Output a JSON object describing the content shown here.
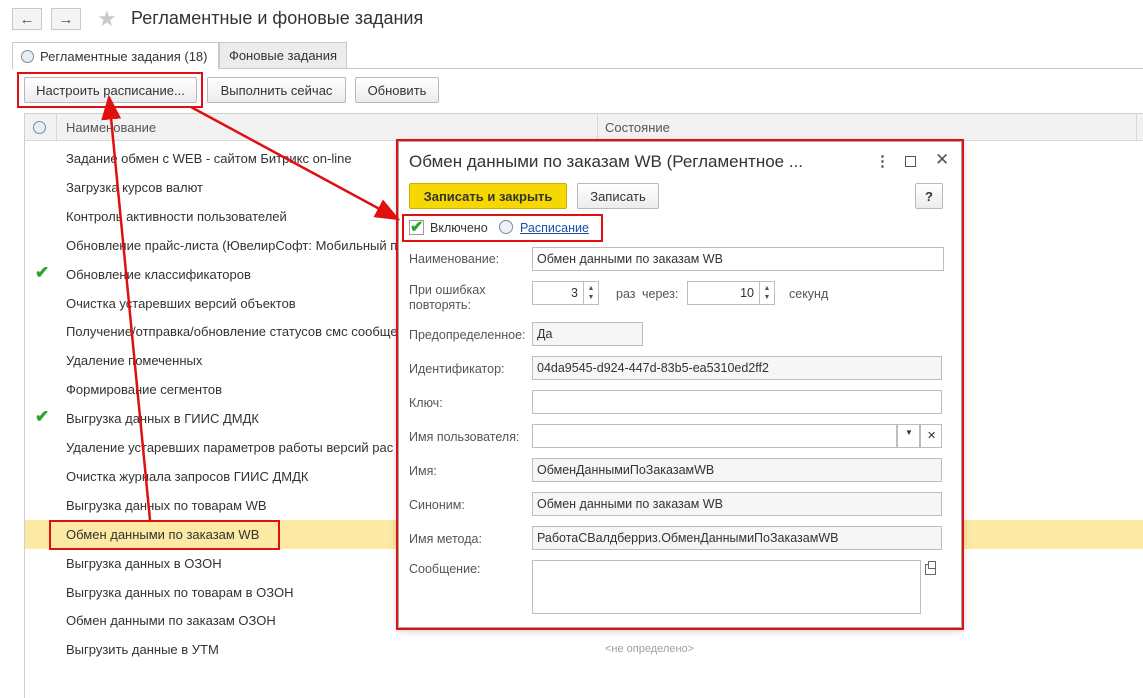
{
  "window": {
    "title": "Регламентные и фоновые задания",
    "back_icon": "arrow-left",
    "forward_icon": "arrow-right",
    "favorite_icon": "star"
  },
  "tabs": [
    {
      "label": "Регламентные задания (18)",
      "active": true
    },
    {
      "label": "Фоновые задания",
      "active": false
    }
  ],
  "toolbar": {
    "configure_schedule": "Настроить расписание...",
    "run_now": "Выполнить сейчас",
    "refresh": "Обновить"
  },
  "list": {
    "columns": [
      "Наименование",
      "Состояние"
    ],
    "rows": [
      {
        "name": "Задание обмен с WEB - сайтом Битрикс on-line",
        "checked": false
      },
      {
        "name": "Загрузка курсов валют",
        "checked": false
      },
      {
        "name": "Контроль активности пользователей",
        "checked": false
      },
      {
        "name": "Обновление прайс-листа (ЮвелирСофт: Мобильный пр",
        "checked": false
      },
      {
        "name": "Обновление классификаторов",
        "checked": true
      },
      {
        "name": "Очистка устаревших версий объектов",
        "checked": false
      },
      {
        "name": "Получение/отправка/обновление статусов смс сообще",
        "checked": false
      },
      {
        "name": "Удаление помеченных",
        "checked": false
      },
      {
        "name": "Формирование сегментов",
        "checked": false
      },
      {
        "name": "Выгрузка данных в ГИИС ДМДК",
        "checked": true
      },
      {
        "name": "Удаление устаревших параметров работы версий рас",
        "checked": false
      },
      {
        "name": "Очистка журнала запросов ГИИС ДМДК",
        "checked": false
      },
      {
        "name": "Выгрузка данных по товарам WB",
        "checked": false
      },
      {
        "name": "Обмен данными по заказам WB",
        "checked": false,
        "selected": true
      },
      {
        "name": "Выгрузка данных в ОЗОН",
        "checked": false
      },
      {
        "name": "Выгрузка данных по товарам в ОЗОН",
        "checked": false
      },
      {
        "name": "Обмен данными по заказам ОЗОН",
        "checked": false
      },
      {
        "name": "Выгрузить данные в УТМ",
        "checked": false,
        "state": "<не определено>"
      }
    ]
  },
  "dialog": {
    "title": "Обмен данными по заказам WB (Регламентное ...",
    "save_close": "Записать и закрыть",
    "save": "Записать",
    "help": "?",
    "enabled_label": "Включено",
    "enabled": true,
    "schedule_link": "Расписание",
    "name_label": "Наименование:",
    "name_value": "Обмен данными по заказам WB",
    "retry_label_1": "При ошибках",
    "retry_label_2": "повторять:",
    "retry_count": "3",
    "times_label": "раз",
    "through_label": "через:",
    "interval": "10",
    "seconds_label": "секунд",
    "predefined_label": "Предопределенное:",
    "predefined_value": "Да",
    "id_label": "Идентификатор:",
    "id_value": "04da9545-d924-447d-83b5-ea5310ed2ff2",
    "key_label": "Ключ:",
    "key_value": "",
    "user_label": "Имя пользователя:",
    "user_value": "",
    "internal_name_label": "Имя:",
    "internal_name_value": "ОбменДаннымиПоЗаказамWB",
    "synonym_label": "Синоним:",
    "synonym_value": "Обмен данными по заказам WB",
    "method_label": "Имя метода:",
    "method_value": "РаботаСВалдберриз.ОбменДаннымиПоЗаказамWB",
    "message_label": "Сообщение:",
    "message_value": ""
  },
  "colors": {
    "highlight": "#e01010",
    "primary_button": "#f5d800",
    "selected_row": "#fbe9a4",
    "check_green": "#2aa52a",
    "link": "#1a4fa0"
  }
}
